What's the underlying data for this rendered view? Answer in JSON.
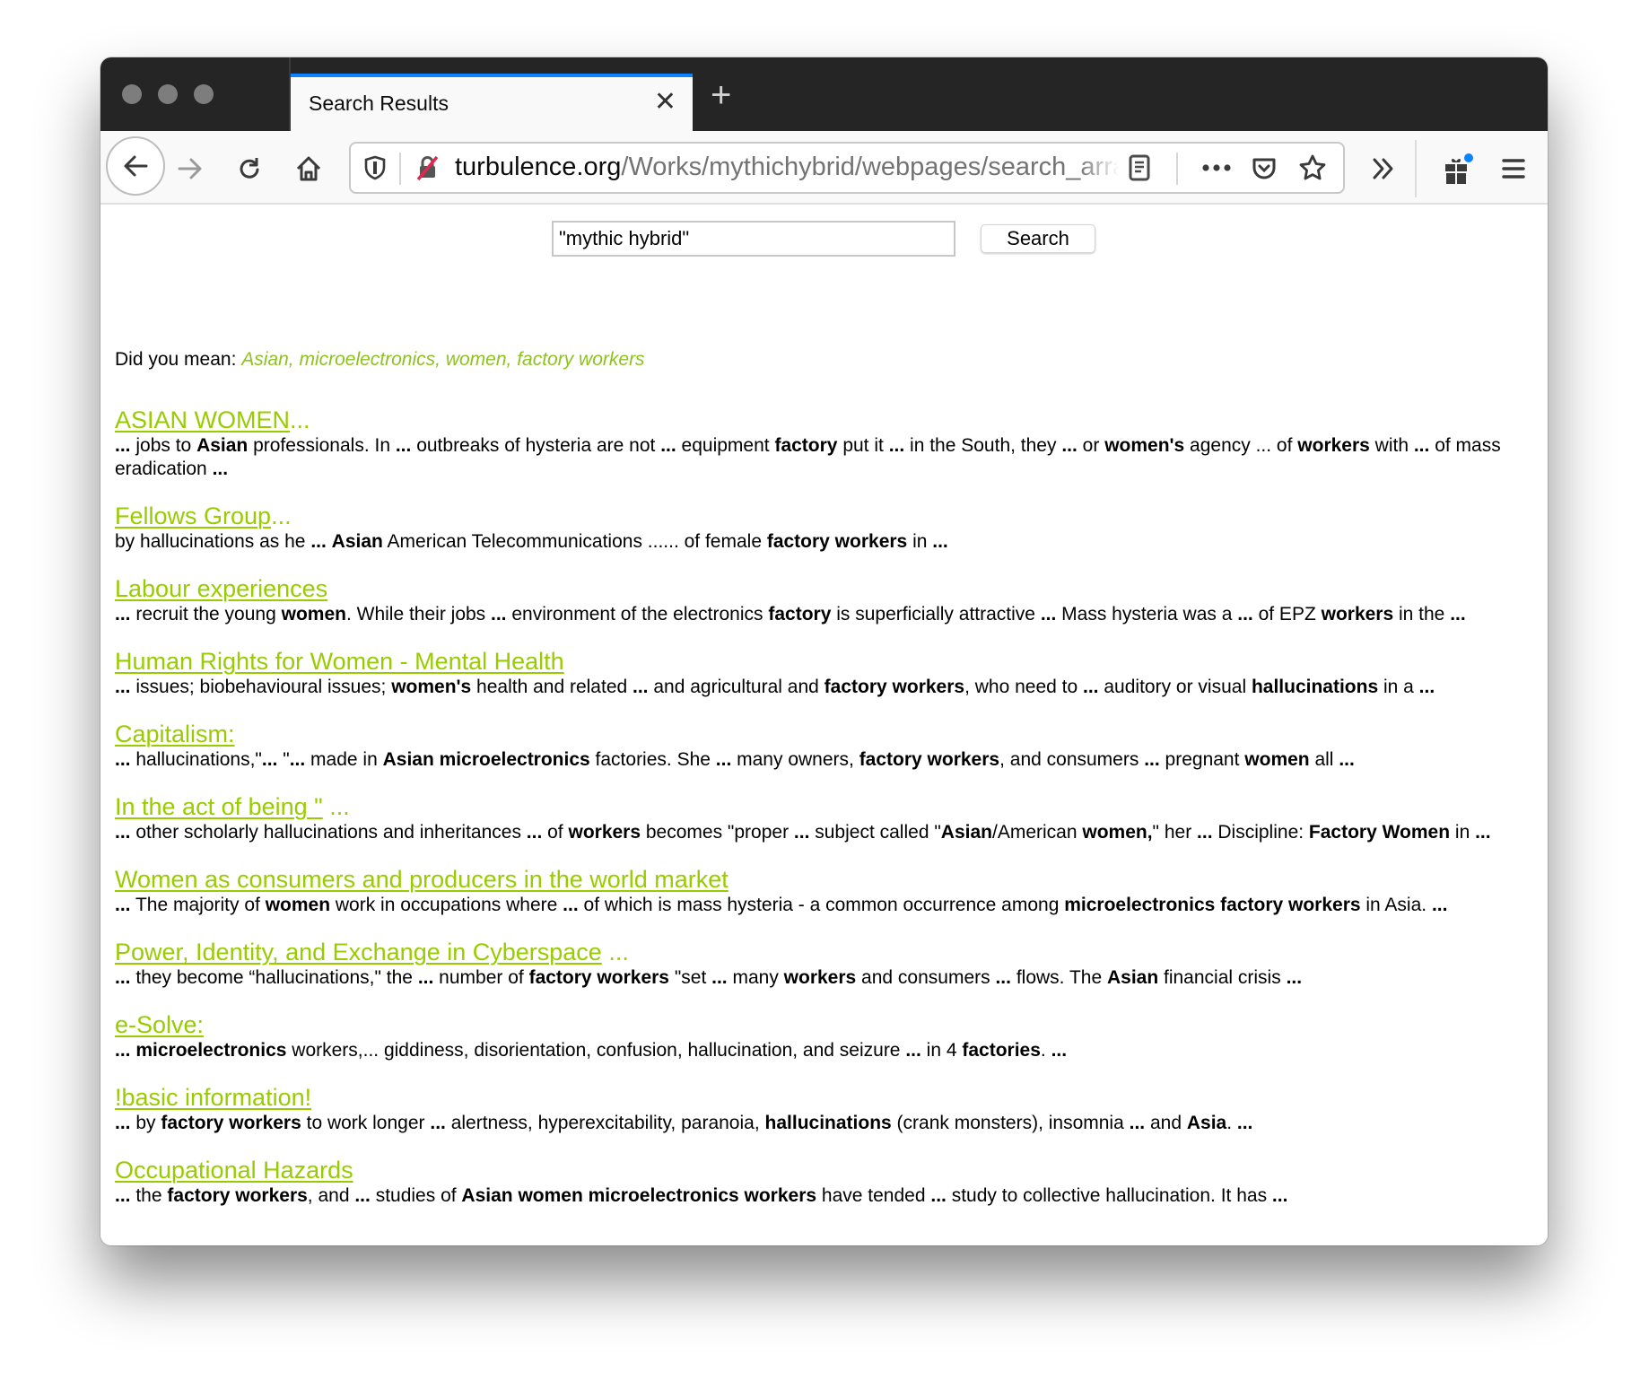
{
  "window": {
    "tab_title": "Search Results",
    "url_host": "turbulence.org",
    "url_path": "/Works/mythichybrid/webpages/search_array"
  },
  "toolbar": {
    "icons": [
      "back-icon",
      "forward-icon",
      "reload-icon",
      "home-icon",
      "shield-icon",
      "insecure-lock-icon",
      "reader-view-icon",
      "more-icon",
      "pocket-icon",
      "bookmark-star-icon",
      "overflow-icon",
      "whats-new-gift-icon",
      "menu-icon"
    ]
  },
  "search": {
    "value": "\"mythic hybrid\"",
    "button_label": "Search"
  },
  "did_you_mean": {
    "label": "Did you mean: ",
    "suggestion": "Asian, microelectronics, women, factory workers"
  },
  "colors": {
    "link": "#99cc00",
    "suggestion": "#8dc21f",
    "tab_accent": "#0a84ff"
  },
  "results": [
    {
      "title": "ASIAN WOMEN",
      "title_suffix": "...",
      "snippet": [
        {
          "t": "...",
          "b": true
        },
        {
          "t": " jobs to "
        },
        {
          "t": "Asian",
          "b": true
        },
        {
          "t": " professionals. In "
        },
        {
          "t": "...",
          "b": true
        },
        {
          "t": " outbreaks of hysteria are not "
        },
        {
          "t": "...",
          "b": true
        },
        {
          "t": " equipment "
        },
        {
          "t": "factory",
          "b": true
        },
        {
          "t": " put it "
        },
        {
          "t": "...",
          "b": true
        },
        {
          "t": " in the South, they "
        },
        {
          "t": "...",
          "b": true
        },
        {
          "t": " or "
        },
        {
          "t": "women's",
          "b": true
        },
        {
          "t": " agency ... of "
        },
        {
          "t": "workers",
          "b": true
        },
        {
          "t": " with "
        },
        {
          "t": "...",
          "b": true
        },
        {
          "t": " of mass eradication "
        },
        {
          "t": "...",
          "b": true
        }
      ]
    },
    {
      "title": "Fellows Group",
      "title_suffix": "...",
      "snippet": [
        {
          "t": "by hallucinations as he "
        },
        {
          "t": "...",
          "b": true
        },
        {
          "t": " "
        },
        {
          "t": "Asian",
          "b": true
        },
        {
          "t": " American Telecommunications ...... of female "
        },
        {
          "t": "factory workers",
          "b": true
        },
        {
          "t": " in "
        },
        {
          "t": "...",
          "b": true
        }
      ]
    },
    {
      "title": "Labour experiences",
      "title_suffix": "",
      "snippet": [
        {
          "t": "...",
          "b": true
        },
        {
          "t": " recruit the young "
        },
        {
          "t": "women",
          "b": true
        },
        {
          "t": ". While their jobs "
        },
        {
          "t": "...",
          "b": true
        },
        {
          "t": " environment of the electronics "
        },
        {
          "t": "factory",
          "b": true
        },
        {
          "t": " is superficially attractive "
        },
        {
          "t": "...",
          "b": true
        },
        {
          "t": " Mass hysteria was a "
        },
        {
          "t": "...",
          "b": true
        },
        {
          "t": " of EPZ "
        },
        {
          "t": "workers",
          "b": true
        },
        {
          "t": " in the "
        },
        {
          "t": "...",
          "b": true
        }
      ]
    },
    {
      "title": "Human Rights for Women - Mental Health",
      "title_suffix": "",
      "snippet": [
        {
          "t": "...",
          "b": true
        },
        {
          "t": " issues; biobehavioural issues; "
        },
        {
          "t": "women's",
          "b": true
        },
        {
          "t": " health and related "
        },
        {
          "t": "...",
          "b": true
        },
        {
          "t": " and agricultural and "
        },
        {
          "t": "factory workers",
          "b": true
        },
        {
          "t": ", who need to "
        },
        {
          "t": "...",
          "b": true
        },
        {
          "t": " auditory or visual "
        },
        {
          "t": "hallucinations",
          "b": true
        },
        {
          "t": " in a "
        },
        {
          "t": "...",
          "b": true
        }
      ]
    },
    {
      "title": "Capitalism:",
      "title_suffix": "",
      "snippet": [
        {
          "t": "...",
          "b": true
        },
        {
          "t": " hallucinations,\""
        },
        {
          "t": "...",
          "b": true
        },
        {
          "t": " \""
        },
        {
          "t": "...",
          "b": true
        },
        {
          "t": " made in "
        },
        {
          "t": "Asian microelectronics",
          "b": true
        },
        {
          "t": " factories. She "
        },
        {
          "t": "...",
          "b": true
        },
        {
          "t": " many owners, "
        },
        {
          "t": "factory workers",
          "b": true
        },
        {
          "t": ", and consumers "
        },
        {
          "t": "...",
          "b": true
        },
        {
          "t": " pregnant "
        },
        {
          "t": "women",
          "b": true
        },
        {
          "t": " all "
        },
        {
          "t": "...",
          "b": true
        }
      ]
    },
    {
      "title": "In the act of being \"",
      "title_suffix": " ...",
      "snippet": [
        {
          "t": "...",
          "b": true
        },
        {
          "t": " other scholarly hallucinations and inheritances "
        },
        {
          "t": "...",
          "b": true
        },
        {
          "t": " of "
        },
        {
          "t": "workers",
          "b": true
        },
        {
          "t": " becomes \"proper "
        },
        {
          "t": "...",
          "b": true
        },
        {
          "t": " subject called \""
        },
        {
          "t": "Asian",
          "b": true
        },
        {
          "t": "/American "
        },
        {
          "t": "women,",
          "b": true
        },
        {
          "t": "\" her "
        },
        {
          "t": "...",
          "b": true
        },
        {
          "t": " Discipline: "
        },
        {
          "t": "Factory Women",
          "b": true
        },
        {
          "t": " in "
        },
        {
          "t": "...",
          "b": true
        }
      ]
    },
    {
      "title": "Women as consumers and producers in the world market",
      "title_suffix": "",
      "snippet": [
        {
          "t": "...",
          "b": true
        },
        {
          "t": " The majority of "
        },
        {
          "t": "women",
          "b": true
        },
        {
          "t": " work in occupations where "
        },
        {
          "t": "...",
          "b": true
        },
        {
          "t": " of which is mass hysteria - a common occurrence among "
        },
        {
          "t": "microelectronics factory workers",
          "b": true
        },
        {
          "t": " in Asia. "
        },
        {
          "t": "...",
          "b": true
        }
      ]
    },
    {
      "title": "Power, Identity, and Exchange in Cyberspace",
      "title_suffix": " ...",
      "snippet": [
        {
          "t": "...",
          "b": true
        },
        {
          "t": " they become “hallucinations,\" the "
        },
        {
          "t": "...",
          "b": true
        },
        {
          "t": " number of "
        },
        {
          "t": "factory workers",
          "b": true
        },
        {
          "t": " \"set "
        },
        {
          "t": "...",
          "b": true
        },
        {
          "t": " many "
        },
        {
          "t": "workers",
          "b": true
        },
        {
          "t": " and consumers "
        },
        {
          "t": "...",
          "b": true
        },
        {
          "t": " flows. The "
        },
        {
          "t": "Asian",
          "b": true
        },
        {
          "t": " financial crisis "
        },
        {
          "t": "...",
          "b": true
        }
      ]
    },
    {
      "title": "e-Solve:",
      "title_suffix": "",
      "snippet": [
        {
          "t": "...",
          "b": true
        },
        {
          "t": " "
        },
        {
          "t": "microelectronics",
          "b": true
        },
        {
          "t": " workers,... giddiness, disorientation, confusion, hallucination, and seizure "
        },
        {
          "t": "...",
          "b": true
        },
        {
          "t": " in 4 "
        },
        {
          "t": "factories",
          "b": true
        },
        {
          "t": ". "
        },
        {
          "t": "...",
          "b": true
        }
      ]
    },
    {
      "title": "!basic information!",
      "title_suffix": "",
      "snippet": [
        {
          "t": "...",
          "b": true
        },
        {
          "t": " by "
        },
        {
          "t": "factory workers",
          "b": true
        },
        {
          "t": " to work longer "
        },
        {
          "t": "...",
          "b": true
        },
        {
          "t": " alertness, hyperexcitability, paranoia, "
        },
        {
          "t": "hallucinations",
          "b": true
        },
        {
          "t": " (crank monsters), insomnia "
        },
        {
          "t": "...",
          "b": true
        },
        {
          "t": " and "
        },
        {
          "t": "Asia",
          "b": true
        },
        {
          "t": ". "
        },
        {
          "t": "...",
          "b": true
        }
      ]
    },
    {
      "title": "Occupational Hazards",
      "title_suffix": "",
      "snippet": [
        {
          "t": "...",
          "b": true
        },
        {
          "t": " the "
        },
        {
          "t": "factory workers",
          "b": true
        },
        {
          "t": ", and "
        },
        {
          "t": "...",
          "b": true
        },
        {
          "t": " studies of "
        },
        {
          "t": "Asian women microelectronics workers",
          "b": true
        },
        {
          "t": " have tended "
        },
        {
          "t": "...",
          "b": true
        },
        {
          "t": " study to collective hallucination. It has "
        },
        {
          "t": "...",
          "b": true
        }
      ]
    }
  ]
}
